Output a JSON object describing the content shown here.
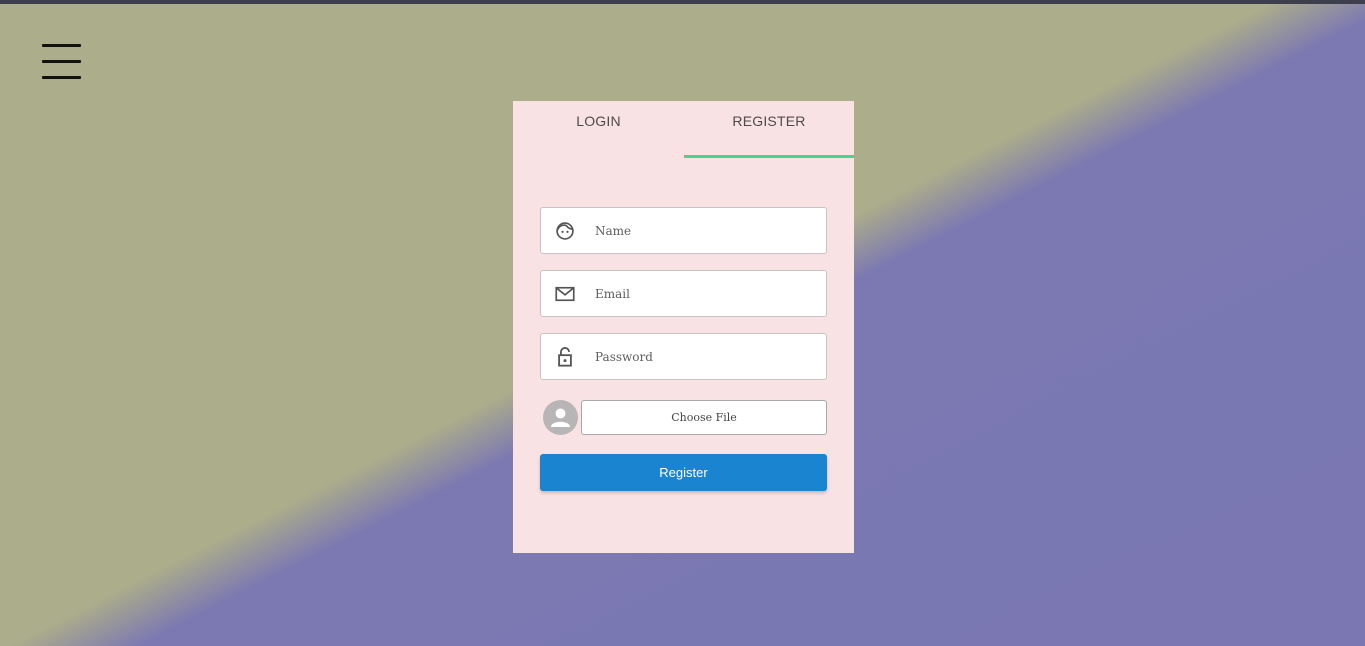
{
  "nav": {
    "menu_icon": "hamburger-menu-icon"
  },
  "tabs": [
    {
      "label": "LOGIN",
      "active": false
    },
    {
      "label": "REGISTER",
      "active": true
    }
  ],
  "colors": {
    "tab_indicator": "#4fd091",
    "register_button": "#1a84d0",
    "card_background": "#f9e2e3"
  },
  "form": {
    "name_field": {
      "placeholder": "Name",
      "value": "",
      "icon": "face-icon"
    },
    "email_field": {
      "placeholder": "Email",
      "value": "",
      "icon": "mail-icon"
    },
    "password_field": {
      "placeholder": "Password",
      "value": "",
      "icon": "lock-open-icon"
    },
    "file": {
      "label": "Choose File",
      "avatar_icon": "user-avatar-icon"
    },
    "submit_label": "Register"
  }
}
